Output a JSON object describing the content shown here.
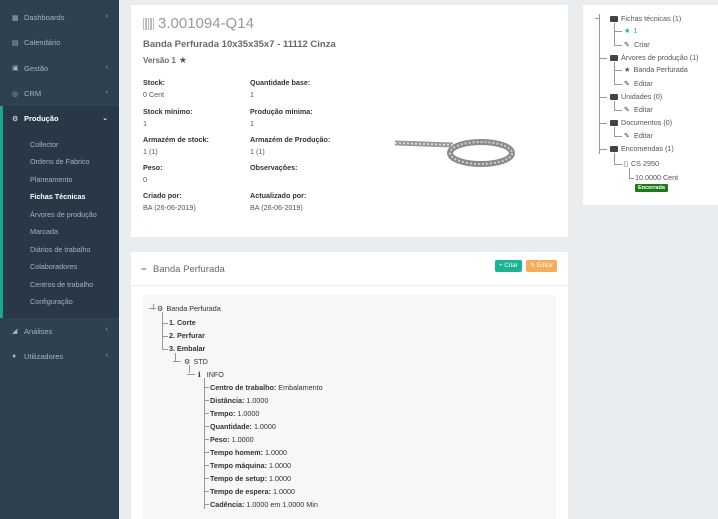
{
  "sidebar": {
    "items": [
      {
        "label": "Dashboards",
        "icon": "table-icon"
      },
      {
        "label": "Calendário",
        "icon": "calendar-icon"
      },
      {
        "label": "Gestão",
        "icon": "window-icon"
      },
      {
        "label": "CRM",
        "icon": "target-icon"
      },
      {
        "label": "Produção",
        "icon": "cogs-icon"
      },
      {
        "label": "Análises",
        "icon": "chart-icon"
      },
      {
        "label": "Utilizadores",
        "icon": "user-icon"
      }
    ],
    "production_sub": [
      "Collector",
      "Ordens de Fabrico",
      "Planeamento",
      "Fichas Técnicas",
      "Árvores de produção",
      "Marcada",
      "Diários de trabalho",
      "Colaboradores",
      "Centros de trabalho",
      "Configuração"
    ]
  },
  "product": {
    "code": "3.001094-Q14",
    "title": "Banda Perfurada 10x35x35x7 - 11112 Cinza",
    "version": "Versão 1",
    "fields": [
      {
        "label": "Stock:",
        "value": "0 Cent"
      },
      {
        "label": "Quantidade base:",
        "value": "1"
      },
      {
        "label": "Stock mínimo:",
        "value": "1"
      },
      {
        "label": "Produção mínima:",
        "value": "1"
      },
      {
        "label": "Armazém de stock:",
        "value": "1 (1)"
      },
      {
        "label": "Armazém de Produção:",
        "value": "1 (1)"
      },
      {
        "label": "Peso:",
        "value": "0"
      },
      {
        "label": "Observações:",
        "value": ""
      },
      {
        "label": "Criado por:",
        "value": "BA (26-06-2019)"
      },
      {
        "label": "Actualizado por:",
        "value": "BA (26-06-2019)"
      }
    ]
  },
  "side_tree": {
    "fichas": "Fichas técnicas (1)",
    "fichas_item": "1",
    "criar": "Criar",
    "arvores": "Árvores de produção (1)",
    "arvore_item": "Banda Perfurada",
    "editar": "Editar",
    "unidades": "Unidades (0)",
    "documentos": "Documentos (0)",
    "encomendas": "Encomendas (1)",
    "encomenda_item": "CS 2950",
    "qty": "10.0000 Cent",
    "status": "Encerrada",
    "status_color": "#1a7b1a"
  },
  "bottom": {
    "title": "Banda Perfurada",
    "btn_new": "+ Criar",
    "btn_edit": "Editar",
    "root": "Banda Perfurada",
    "ops": [
      "1. Corte",
      "2. Perfurar",
      "3. Embalar"
    ],
    "std": "STD",
    "info": "INFO",
    "details": [
      {
        "label": "Centro de trabalho:",
        "value": "Embalamento"
      },
      {
        "label": "Distância:",
        "value": "1.0000"
      },
      {
        "label": "Tempo:",
        "value": "1.0000"
      },
      {
        "label": "Quantidade:",
        "value": "1.0000"
      },
      {
        "label": "Peso:",
        "value": "1.0000"
      },
      {
        "label": "Tempo homem:",
        "value": "1.0000"
      },
      {
        "label": "Tempo máquina:",
        "value": "1.0000"
      },
      {
        "label": "Tempo de setup:",
        "value": "1.0000"
      },
      {
        "label": "Tempo de espera:",
        "value": "1.0000"
      },
      {
        "label": "Cadência:",
        "value": "1.0000 em 1.0000 Min"
      }
    ]
  },
  "colors": {
    "sidebar": "#2f4050",
    "accent": "#19aa8d",
    "create": "#1ab394",
    "edit": "#f8ac59"
  }
}
